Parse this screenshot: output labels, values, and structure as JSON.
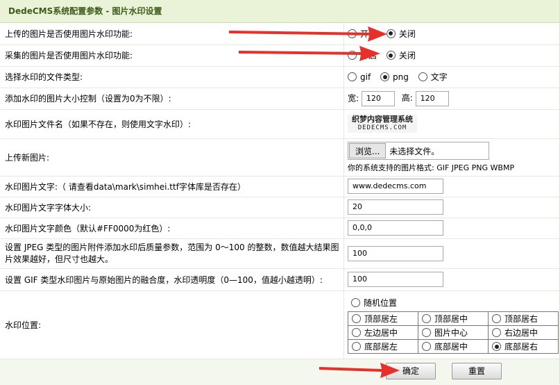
{
  "header": {
    "title": "DedeCMS系统配置参数 - 图片水印设置"
  },
  "rows": {
    "upload_wm": {
      "label": "上传的图片是否使用图片水印功能:",
      "opt_on": "开启",
      "opt_off": "关闭",
      "selected": "关闭"
    },
    "collect_wm": {
      "label": "采集的图片是否使用图片水印功能:",
      "opt_on": "开启",
      "opt_off": "关闭",
      "selected": "关闭"
    },
    "wm_type": {
      "label": "选择水印的文件类型:",
      "opt_gif": "gif",
      "opt_png": "png",
      "opt_text": "文字",
      "selected": "png"
    },
    "size_limit": {
      "label": "添加水印的图片大小控制（设置为0为不限）:",
      "width_label": "宽:",
      "width_value": "120",
      "height_label": "高:",
      "height_value": "120"
    },
    "wm_file": {
      "label": "水印图片文件名（如果不存在，则使用文字水印）:",
      "logo_line1": "织梦内容管理系统",
      "logo_line2": "DEDECMS.COM"
    },
    "upload_new": {
      "label": "上传新图片:",
      "browse_label": "浏览...",
      "no_file": "未选择文件。",
      "support_text": "你的系统支持的图片格式: GIF JPEG PNG WBMP"
    },
    "wm_text": {
      "label": "水印图片文字:（  请查看data\\mark\\simhei.ttf字体库是否存在）",
      "value": "www.dedecms.com"
    },
    "wm_font_size": {
      "label": "水印图片文字字体大小:",
      "value": "20"
    },
    "wm_color": {
      "label": "水印图片文字颜色（默认#FF0000为红色）:",
      "value": "0,0,0"
    },
    "jpeg_quality": {
      "label": "设置 JPEG 类型的图片附件添加水印后质量参数，范围为 0～100 的整数，数值越大结果图片效果越好，但尺寸也越大。",
      "value": "100"
    },
    "gif_opacity": {
      "label": "设置 GIF 类型水印图片与原始图片的融合度，水印透明度（0—100，值越小越透明）:",
      "value": "100"
    },
    "wm_position": {
      "label": "水印位置:",
      "random": "随机位置",
      "grid": [
        [
          "顶部居左",
          "顶部居中",
          "顶部居右"
        ],
        [
          "左边居中",
          "图片中心",
          "右边居中"
        ],
        [
          "底部居左",
          "底部居中",
          "底部居右"
        ]
      ],
      "selected": "底部居右"
    }
  },
  "footer": {
    "ok_label": "确定",
    "reset_label": "重置"
  },
  "colors": {
    "header_bg": "#eaf3d8",
    "header_text": "#3d5b1a",
    "arrow": "#e8302a"
  }
}
